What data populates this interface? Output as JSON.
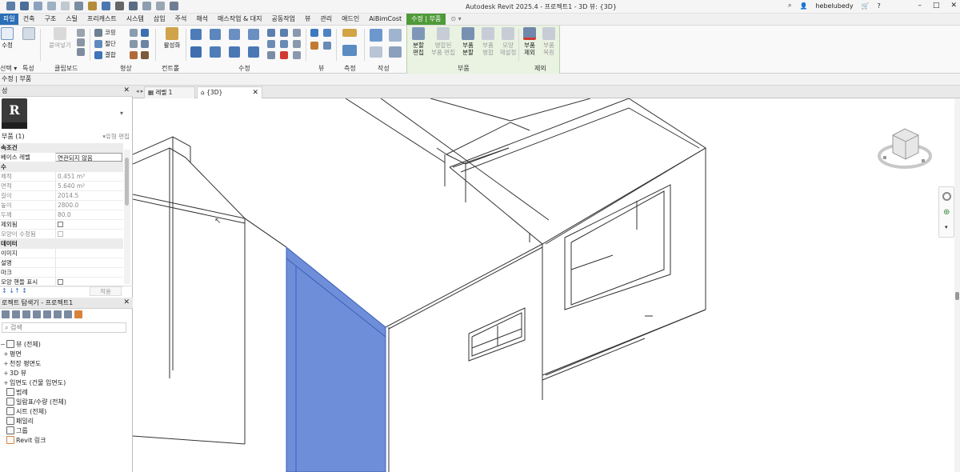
{
  "app_title": "Autodesk Revit 2025.4 - 프로젝트1 - 3D 뷰: {3D}",
  "user": {
    "name": "hebelubedy",
    "help": "?"
  },
  "window_controls": [
    "–",
    "□",
    "✕"
  ],
  "tabs": [
    "파일",
    "건축",
    "구조",
    "스틸",
    "프리캐스트",
    "시스템",
    "삽입",
    "주석",
    "해석",
    "매스작업 & 대지",
    "공동작업",
    "뷰",
    "관리",
    "애드인",
    "AiBimCost",
    "수정 | 부품",
    "⊙ ▾"
  ],
  "ribbon": {
    "select_panel": {
      "modify_label": "수정",
      "label": "선택 ▾"
    },
    "properties_panel": {
      "label": "특성"
    },
    "clipboard_panel": {
      "paste_label": "붙여넣기",
      "label": "클립보드"
    },
    "geometry_panel": {
      "cope": "코핑",
      "cut": "절단",
      "join": "결합",
      "label": "형상"
    },
    "controls_panel": {
      "activate": "활성화",
      "label": "컨트롤"
    },
    "modify_panel": {
      "label": "수정"
    },
    "view_panel": {
      "label": "뷰"
    },
    "measure_panel": {
      "label": "측정"
    },
    "create_panel": {
      "label": "작성"
    },
    "parts_panel": {
      "edit_division": "분할\n편집",
      "merged_part_edit": "병합된\n부품 편집",
      "divide_parts": "부품\n분할",
      "merge_parts": "부품\n병합",
      "restore_shape": "모양\n재설정",
      "label": "부품"
    },
    "exclude_panel": {
      "exclude_parts": "부품\n제외",
      "restore_parts": "부품\n복원",
      "label": "제외"
    }
  },
  "options_bar": "수정 | 부품",
  "properties": {
    "header": "성",
    "type_selector": "부품 (1)",
    "edit_type": "유형 편집",
    "groups": [
      {
        "name": "속조건",
        "rows": [
          {
            "key": "베이스 레벨",
            "value": "연관되지 않음",
            "boxed": true
          }
        ]
      },
      {
        "name": "수",
        "rows": [
          {
            "key": "체적",
            "value": "0.451 m³",
            "gray": true
          },
          {
            "key": "면적",
            "value": "5.640 m²",
            "gray": true
          },
          {
            "key": "길이",
            "value": "2014.5",
            "gray": true
          },
          {
            "key": "높이",
            "value": "2800.0",
            "gray": true
          },
          {
            "key": "두께",
            "value": "80.0",
            "gray": true
          },
          {
            "key": "제외됨",
            "value": "",
            "check": true
          },
          {
            "key": "모양이 수정됨",
            "value": "",
            "check": true,
            "gray": true
          }
        ]
      },
      {
        "name": "데이터",
        "rows": [
          {
            "key": "이미지",
            "value": ""
          },
          {
            "key": "설명",
            "value": ""
          },
          {
            "key": "마크",
            "value": ""
          },
          {
            "key": "모양 핸들 표시",
            "value": "",
            "check": true
          }
        ]
      }
    ],
    "apply": "적용"
  },
  "project_browser": {
    "header": "로젝트 탐색기 - 프로젝트1",
    "search_placeholder": "검색",
    "items": [
      {
        "label": "뷰 (전체)",
        "indent": 0,
        "twisty": "−"
      },
      {
        "label": "평면",
        "indent": 1,
        "twisty": "+"
      },
      {
        "label": "천장 평면도",
        "indent": 1,
        "twisty": "+"
      },
      {
        "label": "3D 뷰",
        "indent": 1,
        "twisty": "+"
      },
      {
        "label": "입면도 (건물 입면도)",
        "indent": 1,
        "twisty": "+"
      },
      {
        "label": "범례",
        "indent": 0,
        "twisty": ""
      },
      {
        "label": "일람표/수량 (전체)",
        "indent": 0,
        "twisty": ""
      },
      {
        "label": "시트 (전체)",
        "indent": 0,
        "twisty": ""
      },
      {
        "label": "패밀리",
        "indent": 0,
        "twisty": ""
      },
      {
        "label": "그룹",
        "indent": 0,
        "twisty": ""
      },
      {
        "label": "Revit 링크",
        "indent": 0,
        "twisty": ""
      }
    ]
  },
  "view_tabs": [
    {
      "label": "레벨 1",
      "active": false
    },
    {
      "label": "{3D}",
      "active": true
    }
  ],
  "colors": {
    "accent": "#4f9a39",
    "file_tab": "#2b6fb7",
    "selection": "#6f8ed9",
    "contextual_bg": "#eaf2e2"
  }
}
